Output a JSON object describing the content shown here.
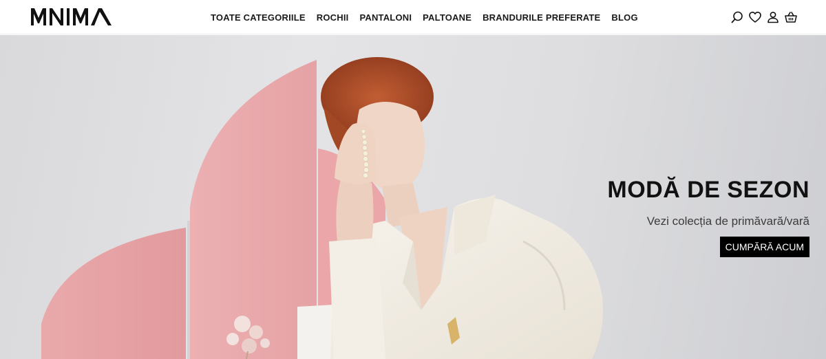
{
  "brand": {
    "logo_text": "MNIMA"
  },
  "nav": {
    "items": [
      {
        "label": "TOATE CATEGORIILE"
      },
      {
        "label": "ROCHII"
      },
      {
        "label": "PANTALONI"
      },
      {
        "label": "PALTOANE"
      },
      {
        "label": "BRANDURILE PREFERATE"
      },
      {
        "label": "BLOG"
      }
    ]
  },
  "header_icons": [
    "search-icon",
    "heart-icon",
    "user-icon",
    "cart-icon"
  ],
  "hero": {
    "title": "MODĂ DE SEZON",
    "subtitle": "Vezi colecția de primăvară/vară",
    "cta_label": "CUMPĂRĂ ACUM"
  },
  "colors": {
    "accent": "#000000",
    "panel_pink": "#e8a6a9",
    "background": "#dcdcde",
    "blazer": "#f3efe6",
    "hair": "#b0502e"
  }
}
